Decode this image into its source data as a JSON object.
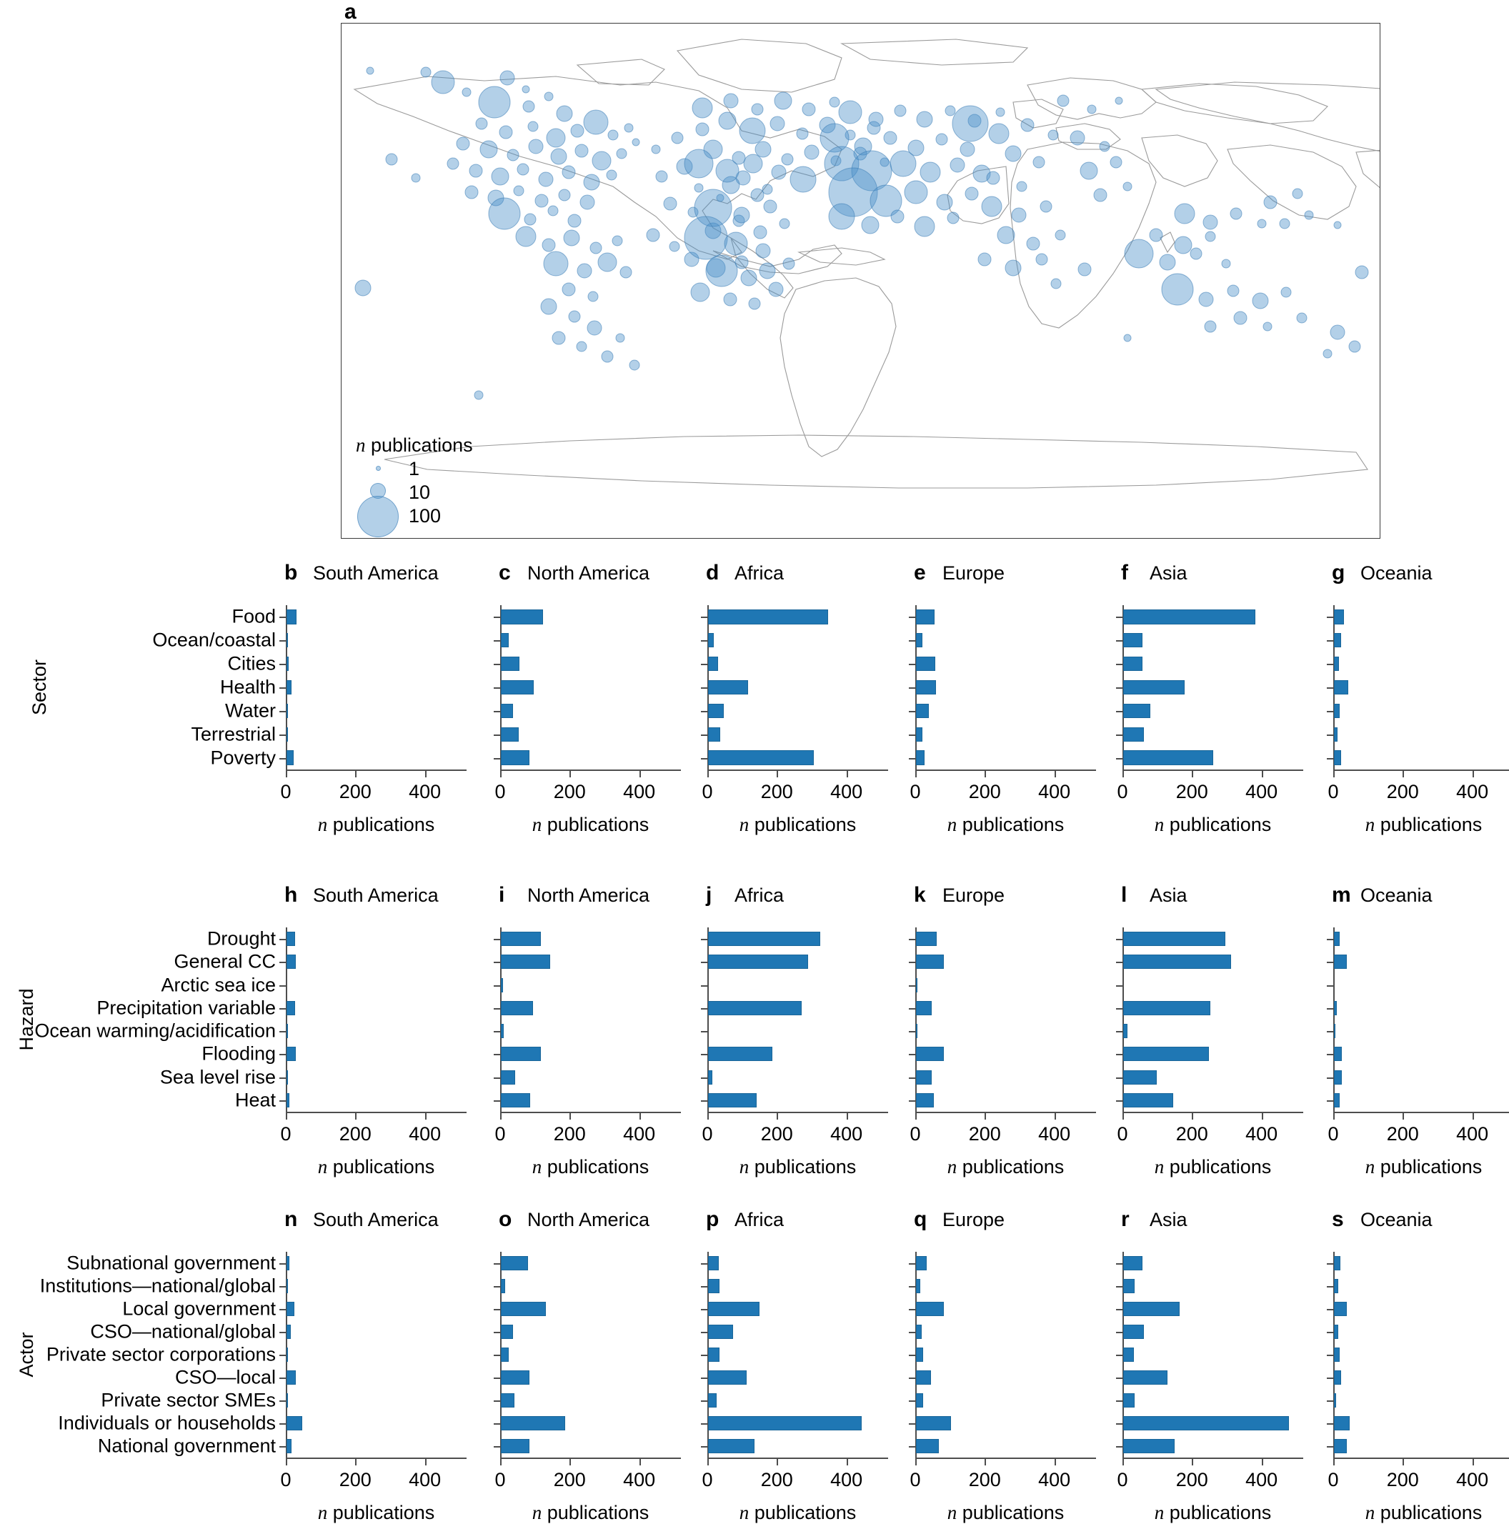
{
  "panel_a": {
    "letter": "a",
    "legend": {
      "title_italic": "n",
      "title_rest": " publications",
      "entries": [
        {
          "label": "1",
          "size": 7
        },
        {
          "label": "10",
          "size": 22
        },
        {
          "label": "100",
          "size": 58
        }
      ]
    }
  },
  "axis": {
    "xlabel_italic": "n",
    "xlabel_rest": " publications",
    "ticks": [
      "0",
      "200",
      "400"
    ],
    "xmax": 520
  },
  "rows": [
    {
      "row_label": "Sector",
      "categories": [
        "Food",
        "Ocean/coastal",
        "Cities",
        "Health",
        "Water",
        "Terrestrial",
        "Poverty"
      ],
      "panels": [
        {
          "letter": "b",
          "title": "South America",
          "values": [
            28,
            2,
            6,
            14,
            5,
            4,
            20
          ]
        },
        {
          "letter": "c",
          "title": "North America",
          "values": [
            122,
            23,
            54,
            95,
            35,
            52,
            82
          ]
        },
        {
          "letter": "d",
          "title": "Africa",
          "values": [
            345,
            16,
            29,
            115,
            45,
            35,
            305
          ]
        },
        {
          "letter": "e",
          "title": "Europe",
          "values": [
            53,
            19,
            55,
            58,
            37,
            19,
            24
          ]
        },
        {
          "letter": "f",
          "title": "Asia",
          "values": [
            380,
            55,
            55,
            176,
            78,
            60,
            259
          ]
        },
        {
          "letter": "g",
          "title": "Oceania",
          "values": [
            29,
            21,
            14,
            41,
            17,
            10,
            21
          ]
        }
      ]
    },
    {
      "row_label": "Hazard",
      "categories": [
        "Drought",
        "General CC",
        "Arctic sea ice",
        "Precipitation variable",
        "Ocean warming/acidification",
        "Flooding",
        "Sea level rise",
        "Heat"
      ],
      "panels": [
        {
          "letter": "h",
          "title": "South America",
          "values": [
            25,
            26,
            0,
            24,
            1,
            26,
            3,
            9
          ]
        },
        {
          "letter": "i",
          "title": "North America",
          "values": [
            115,
            142,
            6,
            93,
            8,
            115,
            41,
            84
          ]
        },
        {
          "letter": "j",
          "title": "Africa",
          "values": [
            322,
            287,
            0,
            270,
            0,
            186,
            12,
            140
          ]
        },
        {
          "letter": "k",
          "title": "Europe",
          "values": [
            60,
            80,
            3,
            46,
            2,
            80,
            46,
            52
          ]
        },
        {
          "letter": "l",
          "title": "Asia",
          "values": [
            294,
            310,
            0,
            250,
            12,
            247,
            96,
            143
          ]
        },
        {
          "letter": "m",
          "title": "Oceania",
          "values": [
            16,
            36,
            0,
            8,
            3,
            22,
            22,
            16
          ]
        }
      ]
    },
    {
      "row_label": "Actor",
      "categories": [
        "Subnational government",
        "Institutions—national/global",
        "Local government",
        "CSO—national/global",
        "Private sector corporations",
        "CSO—local",
        "Private sector SMEs",
        "Individuals or households",
        "National government"
      ],
      "panels": [
        {
          "letter": "n",
          "title": "South America",
          "values": [
            8,
            3,
            22,
            13,
            2,
            26,
            5,
            45,
            14
          ]
        },
        {
          "letter": "o",
          "title": "North America",
          "values": [
            78,
            12,
            130,
            34,
            22,
            82,
            40,
            186,
            82
          ]
        },
        {
          "letter": "p",
          "title": "Africa",
          "values": [
            31,
            33,
            147,
            71,
            33,
            110,
            24,
            441,
            133
          ]
        },
        {
          "letter": "q",
          "title": "Europe",
          "values": [
            31,
            12,
            80,
            17,
            20,
            43,
            20,
            100,
            65
          ]
        },
        {
          "letter": "r",
          "title": "Asia",
          "values": [
            55,
            32,
            162,
            59,
            30,
            127,
            32,
            477,
            147
          ]
        },
        {
          "letter": "s",
          "title": "Oceania",
          "values": [
            18,
            12,
            38,
            12,
            16,
            20,
            6,
            45,
            36
          ]
        }
      ]
    }
  ],
  "chart_data": {
    "type": "bar",
    "title": "Adaptation publications by region, sector, hazard and actor",
    "xlabel": "n publications",
    "ylabel": "",
    "xlim": [
      0,
      520
    ],
    "xticks": [
      0,
      200,
      400
    ],
    "grid": false,
    "legend": "none",
    "orientation": "horizontal",
    "bar_color": "#1f77b4",
    "panels": [
      {
        "id": "a",
        "type": "scatter",
        "title": "",
        "description": "World map of publication counts by study location; bubble area proportional to n publications",
        "legend_entries": [
          1,
          10,
          100
        ],
        "legend_title": "n publications"
      },
      {
        "id": "b",
        "group": "Sector",
        "region": "South America",
        "categories": [
          "Food",
          "Ocean/coastal",
          "Cities",
          "Health",
          "Water",
          "Terrestrial",
          "Poverty"
        ],
        "values": [
          28,
          2,
          6,
          14,
          5,
          4,
          20
        ]
      },
      {
        "id": "c",
        "group": "Sector",
        "region": "North America",
        "categories": [
          "Food",
          "Ocean/coastal",
          "Cities",
          "Health",
          "Water",
          "Terrestrial",
          "Poverty"
        ],
        "values": [
          122,
          23,
          54,
          95,
          35,
          52,
          82
        ]
      },
      {
        "id": "d",
        "group": "Sector",
        "region": "Africa",
        "categories": [
          "Food",
          "Ocean/coastal",
          "Cities",
          "Health",
          "Water",
          "Terrestrial",
          "Poverty"
        ],
        "values": [
          345,
          16,
          29,
          115,
          45,
          35,
          305
        ]
      },
      {
        "id": "e",
        "group": "Sector",
        "region": "Europe",
        "categories": [
          "Food",
          "Ocean/coastal",
          "Cities",
          "Health",
          "Water",
          "Terrestrial",
          "Poverty"
        ],
        "values": [
          53,
          19,
          55,
          58,
          37,
          19,
          24
        ]
      },
      {
        "id": "f",
        "group": "Sector",
        "region": "Asia",
        "categories": [
          "Food",
          "Ocean/coastal",
          "Cities",
          "Health",
          "Water",
          "Terrestrial",
          "Poverty"
        ],
        "values": [
          380,
          55,
          55,
          176,
          78,
          60,
          259
        ]
      },
      {
        "id": "g",
        "group": "Sector",
        "region": "Oceania",
        "categories": [
          "Food",
          "Ocean/coastal",
          "Cities",
          "Health",
          "Water",
          "Terrestrial",
          "Poverty"
        ],
        "values": [
          29,
          21,
          14,
          41,
          17,
          10,
          21
        ]
      },
      {
        "id": "h",
        "group": "Hazard",
        "region": "South America",
        "categories": [
          "Drought",
          "General CC",
          "Arctic sea ice",
          "Precipitation variable",
          "Ocean warming/acidification",
          "Flooding",
          "Sea level rise",
          "Heat"
        ],
        "values": [
          25,
          26,
          0,
          24,
          1,
          26,
          3,
          9
        ]
      },
      {
        "id": "i",
        "group": "Hazard",
        "region": "North America",
        "categories": [
          "Drought",
          "General CC",
          "Arctic sea ice",
          "Precipitation variable",
          "Ocean warming/acidification",
          "Flooding",
          "Sea level rise",
          "Heat"
        ],
        "values": [
          115,
          142,
          6,
          93,
          8,
          115,
          41,
          84
        ]
      },
      {
        "id": "j",
        "group": "Hazard",
        "region": "Africa",
        "categories": [
          "Drought",
          "General CC",
          "Arctic sea ice",
          "Precipitation variable",
          "Ocean warming/acidification",
          "Flooding",
          "Sea level rise",
          "Heat"
        ],
        "values": [
          322,
          287,
          0,
          270,
          0,
          186,
          12,
          140
        ]
      },
      {
        "id": "k",
        "group": "Hazard",
        "region": "Europe",
        "categories": [
          "Drought",
          "General CC",
          "Arctic sea ice",
          "Precipitation variable",
          "Ocean warming/acidification",
          "Flooding",
          "Sea level rise",
          "Heat"
        ],
        "values": [
          60,
          80,
          3,
          46,
          2,
          80,
          46,
          52
        ]
      },
      {
        "id": "l",
        "group": "Hazard",
        "region": "Asia",
        "categories": [
          "Drought",
          "General CC",
          "Arctic sea ice",
          "Precipitation variable",
          "Ocean warming/acidification",
          "Flooding",
          "Sea level rise",
          "Heat"
        ],
        "values": [
          294,
          310,
          0,
          250,
          12,
          247,
          96,
          143
        ]
      },
      {
        "id": "m",
        "group": "Hazard",
        "region": "Oceania",
        "categories": [
          "Drought",
          "General CC",
          "Arctic sea ice",
          "Precipitation variable",
          "Ocean warming/acidification",
          "Flooding",
          "Sea level rise",
          "Heat"
        ],
        "values": [
          16,
          36,
          0,
          8,
          3,
          22,
          22,
          16
        ]
      },
      {
        "id": "n",
        "group": "Actor",
        "region": "South America",
        "categories": [
          "Subnational government",
          "Institutions—national/global",
          "Local government",
          "CSO—national/global",
          "Private sector corporations",
          "CSO—local",
          "Private sector SMEs",
          "Individuals or households",
          "National government"
        ],
        "values": [
          8,
          3,
          22,
          13,
          2,
          26,
          5,
          45,
          14
        ]
      },
      {
        "id": "o",
        "group": "Actor",
        "region": "North America",
        "categories": [
          "Subnational government",
          "Institutions—national/global",
          "Local government",
          "CSO—national/global",
          "Private sector corporations",
          "CSO—local",
          "Private sector SMEs",
          "Individuals or households",
          "National government"
        ],
        "values": [
          78,
          12,
          130,
          34,
          22,
          82,
          40,
          186,
          82
        ]
      },
      {
        "id": "p",
        "group": "Actor",
        "region": "Africa",
        "categories": [
          "Subnational government",
          "Institutions—national/global",
          "Local government",
          "CSO—national/global",
          "Private sector corporations",
          "CSO—local",
          "Private sector SMEs",
          "Individuals or households",
          "National government"
        ],
        "values": [
          31,
          33,
          147,
          71,
          33,
          110,
          24,
          441,
          133
        ]
      },
      {
        "id": "q",
        "group": "Actor",
        "region": "Europe",
        "categories": [
          "Subnational government",
          "Institutions—national/global",
          "Local government",
          "CSO—national/global",
          "Private sector corporations",
          "CSO—local",
          "Private sector SMEs",
          "Individuals or households",
          "National government"
        ],
        "values": [
          31,
          12,
          80,
          17,
          20,
          43,
          20,
          100,
          65
        ]
      },
      {
        "id": "r",
        "group": "Actor",
        "region": "Asia",
        "categories": [
          "Subnational government",
          "Institutions—national/global",
          "Local government",
          "CSO—national/global",
          "Private sector corporations",
          "CSO—local",
          "Private sector SMEs",
          "Individuals or households",
          "National government"
        ],
        "values": [
          55,
          32,
          162,
          59,
          30,
          127,
          32,
          477,
          147
        ]
      },
      {
        "id": "s",
        "group": "Actor",
        "region": "Oceania",
        "categories": [
          "Subnational government",
          "Institutions—national/global",
          "Local government",
          "CSO—national/global",
          "Private sector corporations",
          "CSO—local",
          "Private sector SMEs",
          "Individuals or households",
          "National government"
        ],
        "values": [
          18,
          12,
          38,
          12,
          16,
          20,
          6,
          45,
          36
        ]
      }
    ]
  }
}
